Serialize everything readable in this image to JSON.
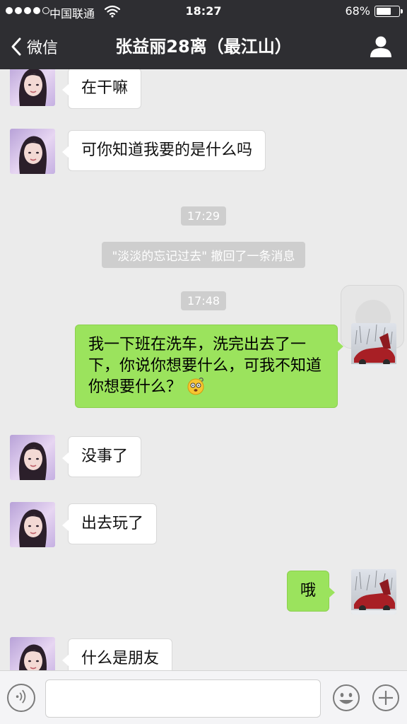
{
  "status_bar": {
    "carrier": "中国联通",
    "time": "18:27",
    "battery": "68%",
    "battery_level": 0.68,
    "signal_bars": 4
  },
  "nav": {
    "back_label": "微信",
    "title": "张益丽28离（最江山）",
    "back_icon": "chevron-left-icon",
    "profile_icon": "person-icon"
  },
  "messages": [
    {
      "side": "in",
      "text": "在干嘛"
    },
    {
      "side": "in",
      "text": "可你知道我要的是什么吗"
    },
    {
      "type": "time",
      "text": "17:29"
    },
    {
      "type": "system",
      "text": "\"淡淡的忘记过去\" 撤回了一条消息"
    },
    {
      "type": "time",
      "text": "17:48"
    },
    {
      "side": "out",
      "text": "我一下班在洗车，洗完出去了一下，你说你想要什么，可我不知道你想要什么？"
    },
    {
      "side": "in",
      "text": "没事了"
    },
    {
      "side": "in",
      "text": "出去玩了"
    },
    {
      "side": "out",
      "text": "哦"
    },
    {
      "side": "in",
      "text": "什么是朋友"
    }
  ],
  "input_bar": {
    "voice_icon": "voice-icon",
    "emoji_icon": "smiley-icon",
    "more_icon": "plus-icon",
    "message_value": ""
  },
  "colors": {
    "nav_bg": "#2e2e32",
    "chat_bg": "#ebebeb",
    "outgoing_bubble": "#9be35d",
    "incoming_bubble": "#ffffff"
  }
}
